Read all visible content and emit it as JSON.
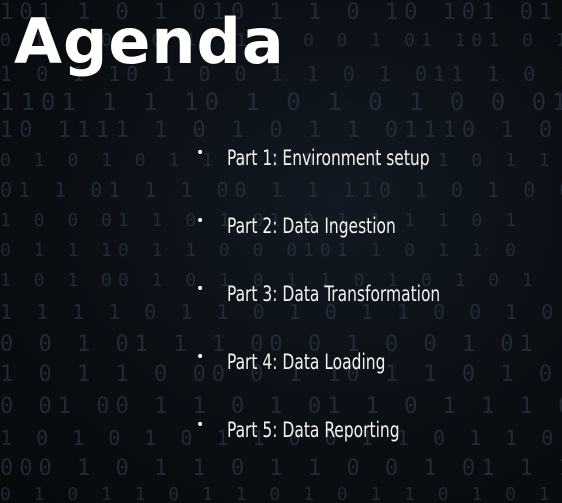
{
  "slide": {
    "title": "Agenda",
    "items": [
      {
        "label": "Part 1: Environment setup"
      },
      {
        "label": "Part 2: Data Ingestion"
      },
      {
        "label": "Part 3: Data Transformation"
      },
      {
        "label": "Part 4: Data Loading"
      },
      {
        "label": "Part 5: Data Reporting"
      }
    ],
    "bullet_glyph": "•"
  },
  "colors": {
    "background": "#0b0f14",
    "text": "#ffffff",
    "binary_digits": "#2a3340"
  }
}
